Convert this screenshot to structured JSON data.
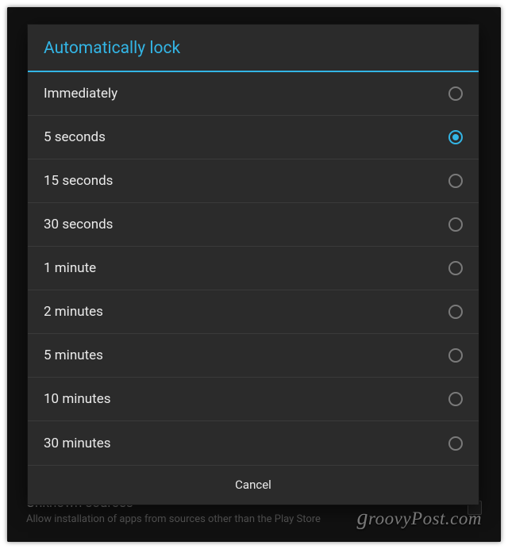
{
  "dialog": {
    "title": "Automatically lock",
    "cancel_label": "Cancel",
    "selected_index": 1,
    "options": [
      {
        "label": "Immediately"
      },
      {
        "label": "5 seconds"
      },
      {
        "label": "15 seconds"
      },
      {
        "label": "30 seconds"
      },
      {
        "label": "1 minute"
      },
      {
        "label": "2 minutes"
      },
      {
        "label": "5 minutes"
      },
      {
        "label": "10 minutes"
      },
      {
        "label": "30 minutes"
      }
    ]
  },
  "background_setting": {
    "title": "Unknown sources",
    "subtitle": "Allow installation of apps from sources other than the Play Store"
  },
  "watermark": "groovyPost.com",
  "colors": {
    "accent": "#33b5e5",
    "dialog_bg": "#2b2b2b",
    "divider": "#3a3a3a",
    "text": "#eaeaea"
  }
}
